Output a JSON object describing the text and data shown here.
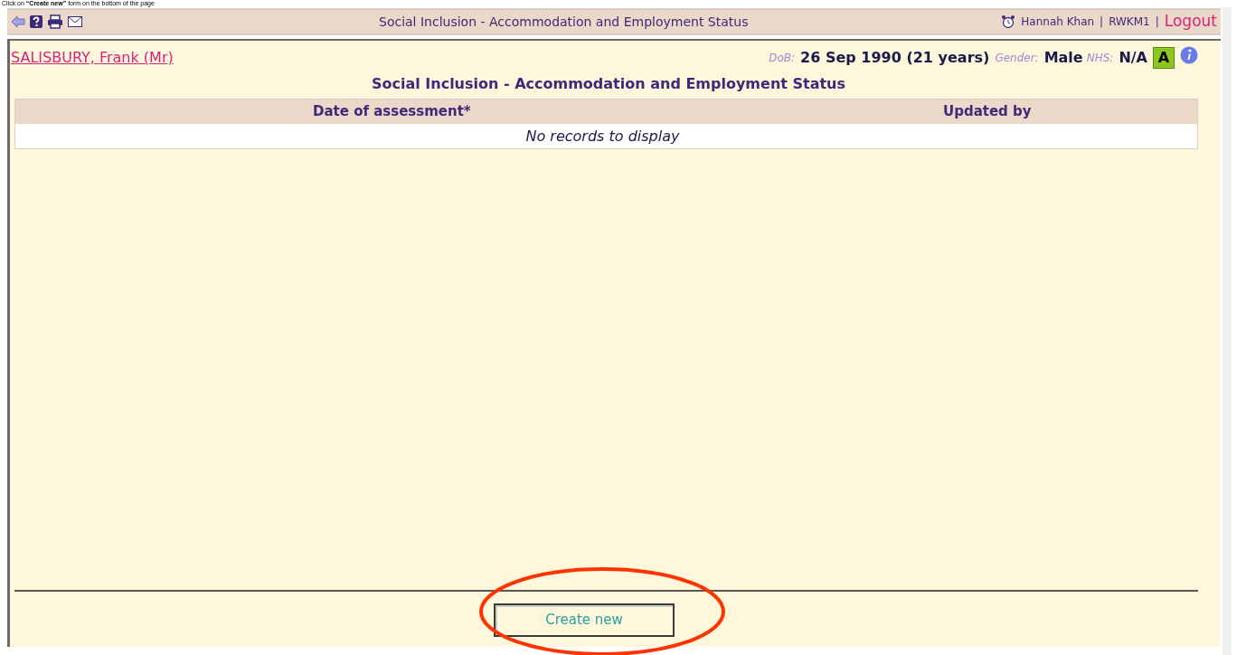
{
  "instruction": "Click on **“Create new”** form on the bottom of the page",
  "toolbar": {
    "title": "Social Inclusion - Accommodation and Employment Status",
    "user": "Hannah Khan",
    "separator_1": "|",
    "code": "RWKM1",
    "separator_2": "|",
    "logout": "Logout"
  },
  "patient": {
    "name": "SALISBURY, Frank (Mr)",
    "dob_label": "DoB:",
    "dob": "26 Sep 1990 (21 years)",
    "gender_label": "Gender:",
    "gender": "Male",
    "nhs_label": "NHS:",
    "nhs": "N/A",
    "badge": "A"
  },
  "form_title": "Social Inclusion - Accommodation and Employment Status",
  "table": {
    "columns": [
      "Date of assessment*",
      "Updated by"
    ],
    "empty_message": "No records to display"
  },
  "buttons": [
    "Create new"
  ]
}
